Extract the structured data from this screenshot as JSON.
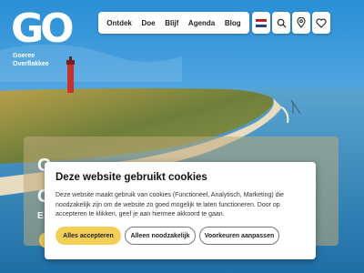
{
  "brand": {
    "logo_main": "GO",
    "logo_line1": "Goeree",
    "logo_line2": "Overflakkee"
  },
  "nav": {
    "items": [
      {
        "label": "Ontdek"
      },
      {
        "label": "Doe"
      },
      {
        "label": "Blijf"
      },
      {
        "label": "Agenda"
      },
      {
        "label": "Blog"
      }
    ],
    "icons": [
      "dutch-flag-icon",
      "search-icon",
      "location-pin-icon",
      "heart-icon"
    ]
  },
  "hero": {
    "peek_letters": [
      "G",
      "G",
      "E"
    ]
  },
  "cookie_banner": {
    "title": "Deze website gebruikt cookies",
    "text": "Deze website maakt gebruik van cookies (Functioneel, Analytisch, Marketing) die noodzakelijk zijn om de website zo goed mogelijk te laten functioneren. Door op accepteren te klikken, geef je aan hiermee akkoord te gaan.",
    "accept_label": "Alles accepteren",
    "necessary_label": "Alleen noodzakelijk",
    "preferences_label": "Voorkeuren aanpassen"
  },
  "colors": {
    "accent_yellow": "#f3cf58",
    "sky_top": "#2a8fd6",
    "sea": "#2f7fb3"
  }
}
